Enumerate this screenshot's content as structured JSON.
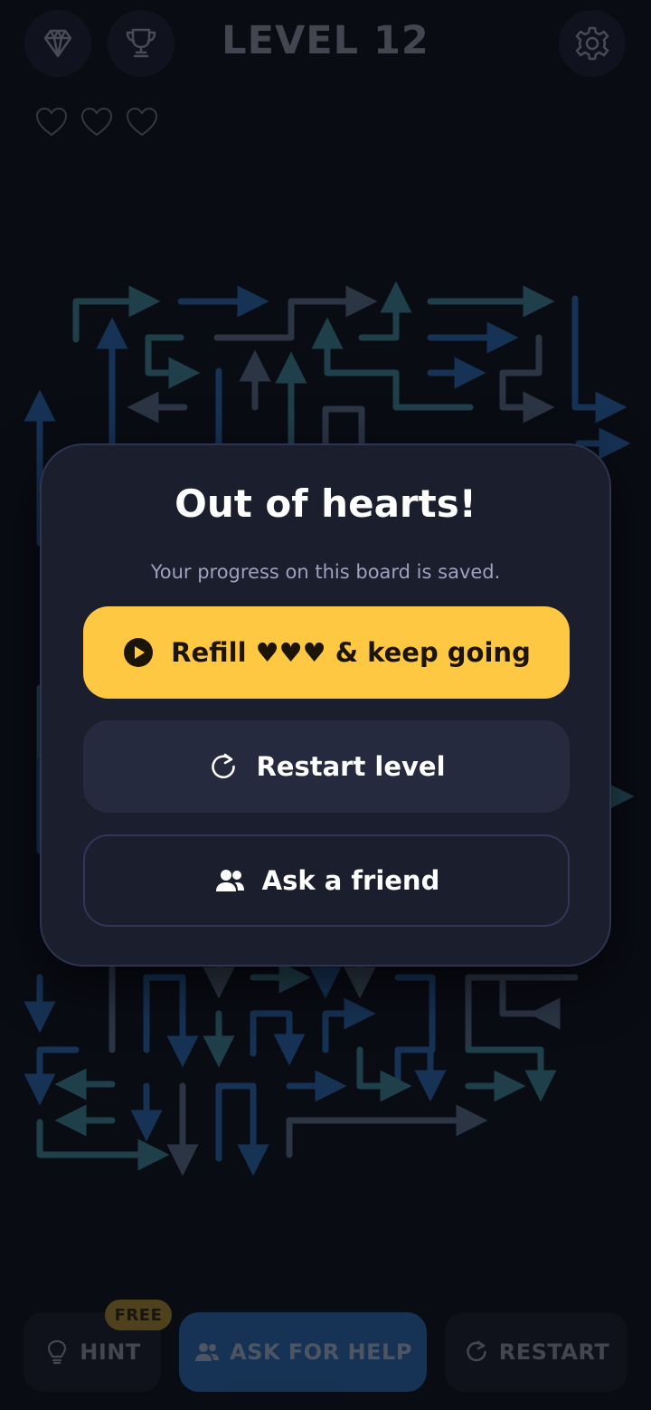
{
  "header": {
    "level_title": "LEVEL 12",
    "left_buttons": [
      "gem-icon",
      "trophy-icon"
    ],
    "right_button": "gear-icon"
  },
  "hearts": {
    "remaining": 0,
    "max": 3
  },
  "modal": {
    "title": "Out of hearts!",
    "subtitle": "Your progress on this board is saved.",
    "refill_label": "Refill ♥♥♥ & keep going",
    "restart_label": "Restart level",
    "ask_friend_label": "Ask a friend"
  },
  "bottom_bar": {
    "hint_label": "HINT",
    "hint_badge": "FREE",
    "help_label": "ASK FOR HELP",
    "restart_label": "RESTART"
  },
  "colors": {
    "background": "#0a0c14",
    "modal_bg": "#1b1e2c",
    "accent_yellow": "#fec843",
    "arrow_blue": "#2f7fd6",
    "arrow_slate": "#6f8aa6",
    "arrow_teal": "#4aa8b8"
  }
}
